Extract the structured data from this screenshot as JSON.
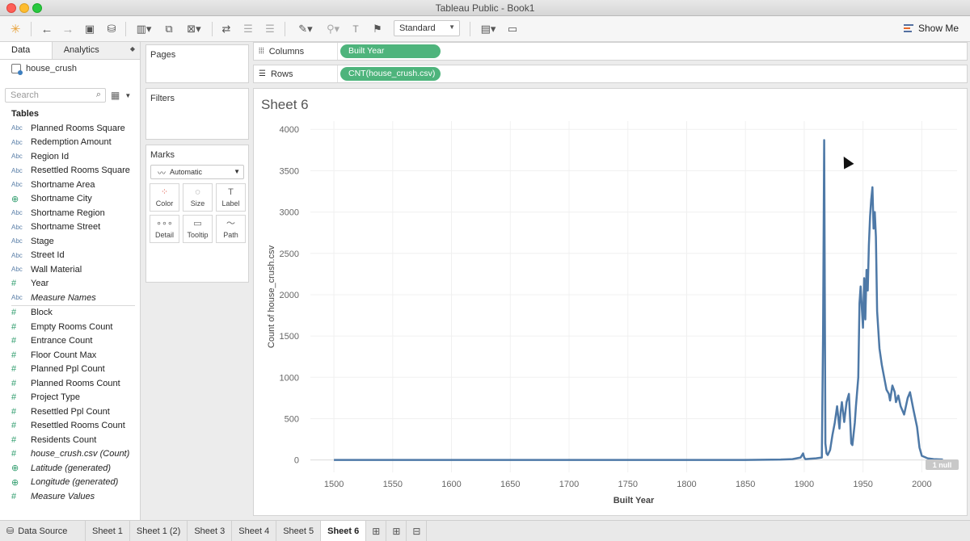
{
  "window": {
    "title": "Tableau Public - Book1"
  },
  "toolbar": {
    "fit_select": "Standard",
    "show_me": "Show Me"
  },
  "left_pane": {
    "tab_data": "Data",
    "tab_analytics": "Analytics",
    "datasource": "house_crush",
    "search_placeholder": "Search",
    "tables_heading": "Tables",
    "dimensions": [
      {
        "type": "Abc",
        "name": "Planned Rooms Square"
      },
      {
        "type": "Abc",
        "name": "Redemption Amount"
      },
      {
        "type": "Abc",
        "name": "Region Id"
      },
      {
        "type": "Abc",
        "name": "Resettled Rooms Square"
      },
      {
        "type": "Abc",
        "name": "Shortname Area"
      },
      {
        "type": "geo",
        "name": "Shortname City"
      },
      {
        "type": "Abc",
        "name": "Shortname Region"
      },
      {
        "type": "Abc",
        "name": "Shortname Street"
      },
      {
        "type": "Abc",
        "name": "Stage"
      },
      {
        "type": "Abc",
        "name": "Street Id"
      },
      {
        "type": "Abc",
        "name": "Wall Material"
      },
      {
        "type": "#",
        "name": "Year"
      },
      {
        "type": "Abc",
        "name": "Measure Names",
        "italic": true
      }
    ],
    "measures": [
      {
        "type": "#",
        "name": "Block"
      },
      {
        "type": "#",
        "name": "Empty Rooms Count"
      },
      {
        "type": "#",
        "name": "Entrance Count"
      },
      {
        "type": "#",
        "name": "Floor Count Max"
      },
      {
        "type": "#",
        "name": "Planned Ppl Count"
      },
      {
        "type": "#",
        "name": "Planned Rooms Count"
      },
      {
        "type": "#",
        "name": "Project Type"
      },
      {
        "type": "#",
        "name": "Resettled Ppl Count"
      },
      {
        "type": "#",
        "name": "Resettled Rooms Count"
      },
      {
        "type": "#",
        "name": "Residents Count"
      },
      {
        "type": "#",
        "name": "house_crush.csv (Count)",
        "italic": true
      },
      {
        "type": "geo",
        "name": "Latitude (generated)",
        "italic": true
      },
      {
        "type": "geo",
        "name": "Longitude (generated)",
        "italic": true
      },
      {
        "type": "#",
        "name": "Measure Values",
        "italic": true
      }
    ]
  },
  "cards": {
    "pages": "Pages",
    "filters": "Filters",
    "marks": "Marks",
    "mark_type": "Automatic",
    "mark_buttons": [
      "Color",
      "Size",
      "Label",
      "Detail",
      "Tooltip",
      "Path"
    ]
  },
  "shelves": {
    "columns_label": "Columns",
    "columns_pill": "Built Year",
    "rows_label": "Rows",
    "rows_pill": "CNT(house_crush.csv)"
  },
  "sheet": {
    "title": "Sheet 6",
    "null_badge": "1 null"
  },
  "chart_data": {
    "type": "line",
    "title": "Sheet 6",
    "xlabel": "Built Year",
    "ylabel": "Count of house_crush.csv",
    "xlim": [
      1480,
      2030
    ],
    "ylim": [
      -150,
      4100
    ],
    "x_ticks": [
      1500,
      1550,
      1600,
      1650,
      1700,
      1750,
      1800,
      1850,
      1900,
      1950,
      2000
    ],
    "y_ticks": [
      0,
      500,
      1000,
      1500,
      2000,
      2500,
      3000,
      3500,
      4000
    ],
    "grid": true,
    "color": "#4e79a7",
    "series": [
      {
        "x": [
          1500,
          1600,
          1700,
          1800,
          1850,
          1880,
          1890,
          1897,
          1899,
          1900,
          1901,
          1905,
          1910,
          1915,
          1916,
          1917,
          1918,
          1919,
          1920,
          1922,
          1924,
          1926,
          1928,
          1930,
          1931,
          1932,
          1934,
          1936,
          1938,
          1940,
          1941,
          1943,
          1944,
          1946,
          1947,
          1948,
          1950,
          1951,
          1952,
          1953,
          1954,
          1955,
          1956,
          1957,
          1958,
          1959,
          1960,
          1961,
          1962,
          1964,
          1966,
          1968,
          1970,
          1972,
          1973,
          1975,
          1977,
          1978,
          1980,
          1982,
          1985,
          1988,
          1990,
          1993,
          1996,
          1998,
          2000,
          2005,
          2010,
          2018
        ],
        "y": [
          0,
          0,
          0,
          0,
          0,
          5,
          10,
          30,
          80,
          30,
          10,
          15,
          20,
          30,
          1500,
          3870,
          200,
          80,
          60,
          120,
          300,
          450,
          650,
          380,
          580,
          700,
          460,
          700,
          800,
          200,
          180,
          450,
          650,
          1000,
          1900,
          2100,
          1600,
          2200,
          1700,
          2300,
          2050,
          2600,
          2950,
          3150,
          3300,
          2800,
          3000,
          2700,
          1800,
          1350,
          1150,
          1000,
          850,
          800,
          720,
          900,
          820,
          700,
          780,
          650,
          550,
          750,
          820,
          600,
          400,
          150,
          50,
          20,
          10,
          5
        ]
      }
    ]
  }
}
